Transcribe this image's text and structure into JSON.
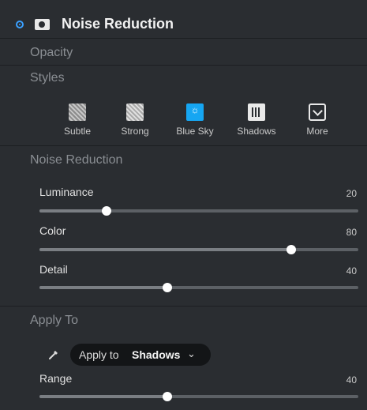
{
  "header": {
    "title": "Noise Reduction",
    "icons": [
      "radio-enabled-icon",
      "camera-icon"
    ]
  },
  "sections": {
    "opacity": "Opacity",
    "styles": "Styles",
    "noise_reduction": "Noise Reduction",
    "apply_to": "Apply To"
  },
  "styles": [
    {
      "label": "Subtle",
      "icon": "subtle-icon"
    },
    {
      "label": "Strong",
      "icon": "strong-icon"
    },
    {
      "label": "Blue Sky",
      "icon": "blue-sky-icon"
    },
    {
      "label": "Shadows",
      "icon": "shadows-icon"
    },
    {
      "label": "More",
      "icon": "more-chevron-icon"
    }
  ],
  "sliders": {
    "luminance": {
      "label": "Luminance",
      "value": "20",
      "fraction": 0.21
    },
    "color": {
      "label": "Color",
      "value": "80",
      "fraction": 0.79
    },
    "detail": {
      "label": "Detail",
      "value": "40",
      "fraction": 0.4
    },
    "range": {
      "label": "Range",
      "value": "40",
      "fraction": 0.4
    }
  },
  "apply_to": {
    "prefix": "Apply to",
    "value": "Shadows",
    "chevron": "⌄",
    "icon": "eyedropper-icon"
  },
  "colors": {
    "accent": "#3aa0ff",
    "panel_bg": "#2a2d31",
    "pill_bg": "#131517",
    "blue_sky": "#16a6f2"
  }
}
